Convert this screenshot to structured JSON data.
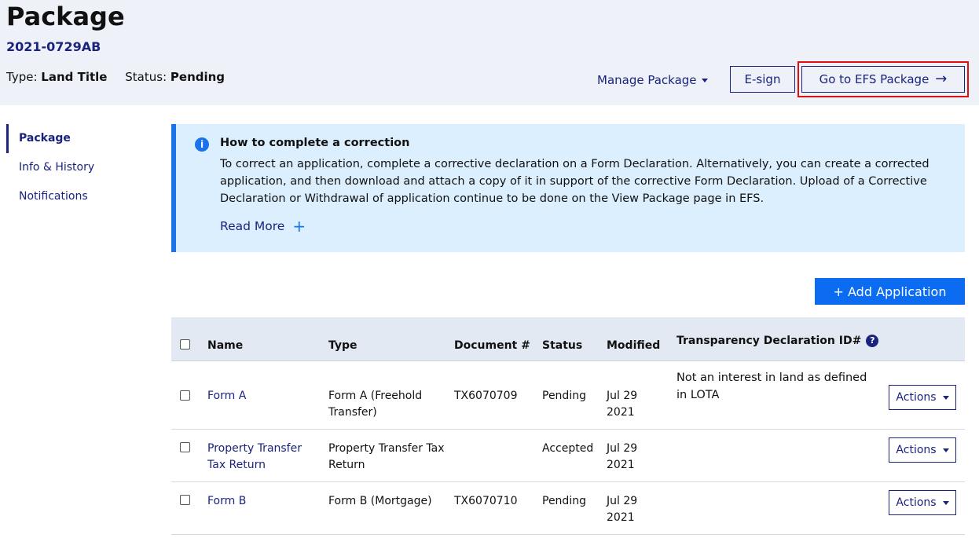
{
  "header": {
    "title": "Package",
    "package_id": "2021-0729AB",
    "type_label": "Type:",
    "type_value": "Land Title",
    "status_label": "Status:",
    "status_value": "Pending",
    "manage_label": "Manage Package",
    "esign_label": "E-sign",
    "efs_label": "Go to EFS Package"
  },
  "sidebar": {
    "items": [
      {
        "label": "Package",
        "active": true
      },
      {
        "label": "Info & History",
        "active": false
      },
      {
        "label": "Notifications",
        "active": false
      }
    ]
  },
  "info": {
    "title": "How to complete a correction",
    "body": "To correct an application, complete a corrective declaration on a Form Declaration. Alternatively, you can create a corrected application, and then download and attach a copy of it in support of the corrective Form Declaration. Upload of a Corrective Declaration or Withdrawal of application continue to be done on the View Package page in EFS.",
    "read_more": "Read More"
  },
  "add_button": "+ Add Application",
  "table": {
    "headers": {
      "name": "Name",
      "type": "Type",
      "document": "Document #",
      "status": "Status",
      "modified": "Modified",
      "transparency": "Transparency Declaration ID#"
    },
    "actions_label": "Actions",
    "rows": [
      {
        "name": "Form A",
        "type": "Form A (Freehold Transfer)",
        "document": "TX6070709",
        "status": "Pending",
        "modified": "Jul 29 2021",
        "transparency": "Not an interest in land as defined in LOTA"
      },
      {
        "name": "Property Transfer Tax Return",
        "type": "Property Transfer Tax Return",
        "document": "",
        "status": "Accepted",
        "modified": "Jul 29 2021",
        "transparency": ""
      },
      {
        "name": "Form B",
        "type": "Form B (Mortgage)",
        "document": "TX6070710",
        "status": "Pending",
        "modified": "Jul 29 2021",
        "transparency": ""
      }
    ]
  },
  "colors": {
    "accent": "#1a237e",
    "primary_button": "#0b6cf2",
    "info_bg": "#dcefff",
    "highlight_outline": "#e01010"
  }
}
